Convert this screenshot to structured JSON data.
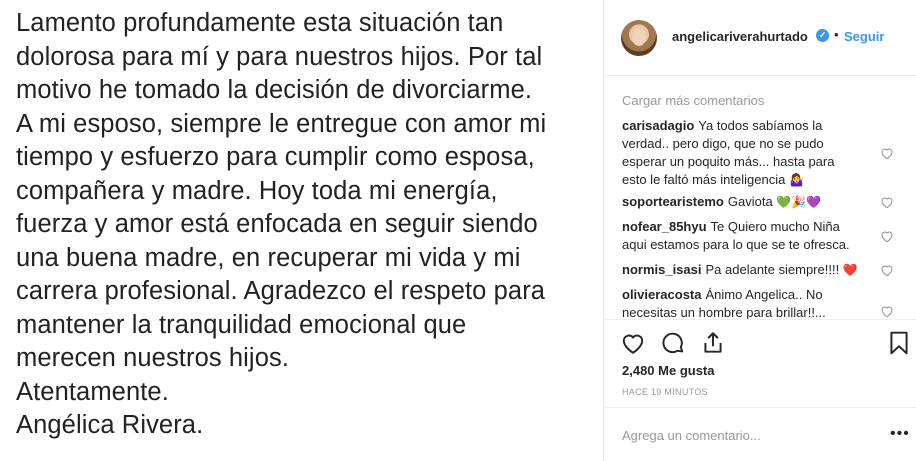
{
  "post_image": {
    "lines": [
      "Lamento profundamente esta situación tan",
      "dolorosa para mí y para nuestros hijos. Por tal",
      "motivo he tomado la decisión de divorciarme.",
      "A mi esposo, siempre le entregue con amor mi",
      "tiempo y esfuerzo para cumplir como esposa,",
      "compañera y madre. Hoy toda mi energía,",
      "fuerza y amor está enfocada en seguir siendo",
      "una buena madre, en recuperar mi vida y mi",
      "carrera profesional. Agradezco el respeto para",
      "mantener la tranquilidad emocional que",
      "merecen nuestros hijos.",
      "Atentamente.",
      "Angélica Rivera."
    ]
  },
  "header": {
    "username": "angelicariverahurtado",
    "separator": "•",
    "follow_label": "Seguir",
    "verified_mark": "✓"
  },
  "comments": {
    "load_more": "Cargar más comentarios",
    "items": [
      {
        "user": "carisadagio",
        "text": "Ya todos sabíamos la verdad.. pero digo, que no se pudo esperar un poquito más... hasta para esto le faltó más inteligencia",
        "emoji": "🤷‍♀️"
      },
      {
        "user": "soportearistemo",
        "text": "Gaviota",
        "emoji": "💚🎉💜"
      },
      {
        "user": "nofear_85hyu",
        "text": "Te Quiero mucho Niña aqui estamos para lo que se te ofresca.",
        "emoji": ""
      },
      {
        "user": "normis_isasi",
        "text": "Pa adelante siempre!!!!",
        "emoji": "❤️"
      },
      {
        "user": "olivieracosta",
        "text": "Ánimo Angelica.. No necesitas un hombre para brillar!!...",
        "emoji": ""
      }
    ]
  },
  "actions": {
    "like_icon": "heart-outline-icon",
    "comment_icon": "comment-bubble-icon",
    "share_icon": "share-arrow-icon",
    "save_icon": "bookmark-icon"
  },
  "likes": "2,480 Me gusta",
  "time_ago": "HACE 19 MINUTOS",
  "add_comment": {
    "placeholder": "Agrega un comentario...",
    "more_label": "•••"
  },
  "colors": {
    "link_blue": "#3897f0",
    "text": "#262626",
    "muted": "#999999",
    "border": "#efefef"
  }
}
